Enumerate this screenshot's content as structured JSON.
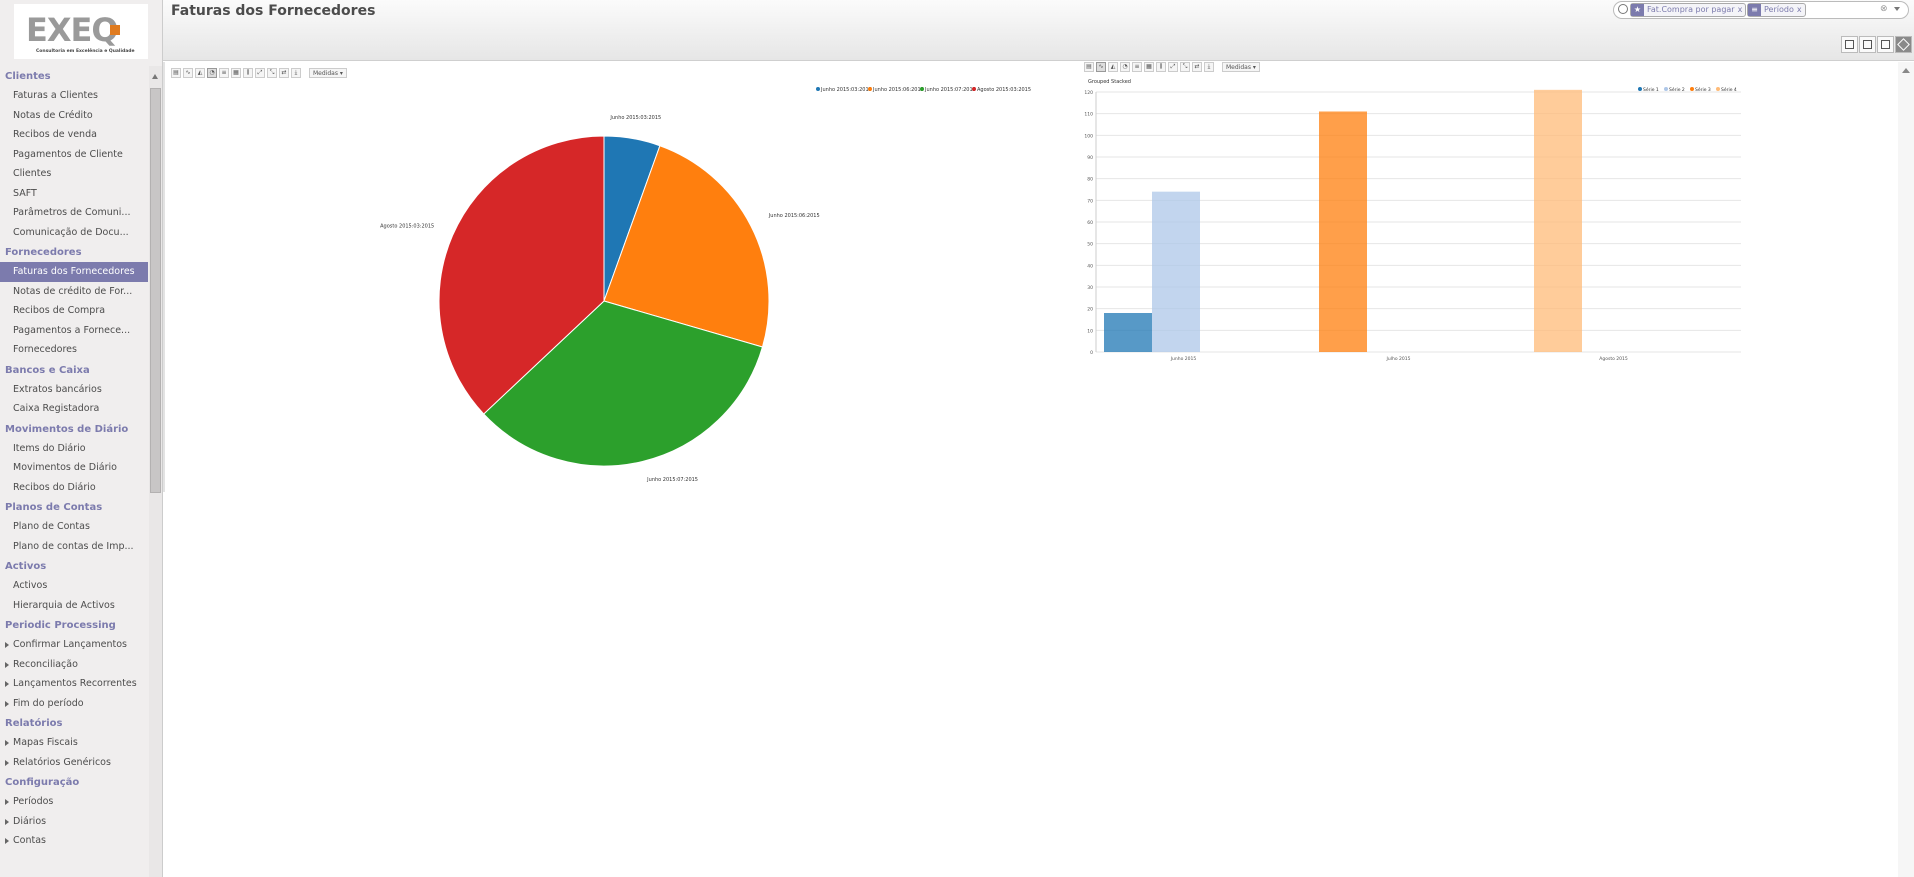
{
  "header": {
    "title": "Faturas dos Fornecedores",
    "search": {
      "facets": [
        {
          "icon": "star-icon",
          "label": "Fat.Compra por pagar"
        },
        {
          "icon": "filter-icon",
          "label": "Período"
        }
      ],
      "remove_glyph": "x",
      "clear_glyph": "⊗"
    },
    "views": [
      "list-view",
      "form-view",
      "calendar-view",
      "graph-view"
    ],
    "active_view": "graph-view"
  },
  "logo": {
    "text": "EXEQ",
    "tagline": "Consultoria em Excelência e Qualidade",
    "colors": {
      "gray": "#8f8f8f",
      "orange": "#e07b1f"
    }
  },
  "sidebar": {
    "sections": [
      {
        "title": "Clientes",
        "items": [
          {
            "label": "Faturas a Clientes"
          },
          {
            "label": "Notas de Crédito"
          },
          {
            "label": "Recibos de venda"
          },
          {
            "label": "Pagamentos de Cliente"
          },
          {
            "label": "Clientes"
          },
          {
            "label": "SAFT"
          },
          {
            "label": "Parâmetros de Comuni..."
          },
          {
            "label": "Comunicação de Docu..."
          }
        ]
      },
      {
        "title": "Fornecedores",
        "items": [
          {
            "label": "Faturas dos Fornecedores",
            "active": true
          },
          {
            "label": "Notas de crédito de For..."
          },
          {
            "label": "Recibos de Compra"
          },
          {
            "label": "Pagamentos a Fornece..."
          },
          {
            "label": "Fornecedores"
          }
        ]
      },
      {
        "title": "Bancos e Caixa",
        "items": [
          {
            "label": "Extratos bancários"
          },
          {
            "label": "Caixa Registadora"
          }
        ]
      },
      {
        "title": "Movimentos de Diário",
        "items": [
          {
            "label": "Items do Diário"
          },
          {
            "label": "Movimentos de Diário"
          },
          {
            "label": "Recibos do Diário"
          }
        ]
      },
      {
        "title": "Planos de Contas",
        "items": [
          {
            "label": "Plano de Contas"
          },
          {
            "label": "Plano de contas de Imp..."
          }
        ]
      },
      {
        "title": "Activos",
        "items": [
          {
            "label": "Activos"
          },
          {
            "label": "Hierarquia de Activos"
          }
        ]
      },
      {
        "title": "Periodic Processing",
        "items": [
          {
            "label": "Confirmar Lançamentos",
            "sub": true
          },
          {
            "label": "Reconciliação",
            "sub": true
          },
          {
            "label": "Lançamentos Recorrentes",
            "sub": true
          },
          {
            "label": "Fim do período",
            "sub": true
          }
        ]
      },
      {
        "title": "Relatórios",
        "items": [
          {
            "label": "Mapas Fiscais",
            "sub": true
          },
          {
            "label": "Relatórios Genéricos",
            "sub": true
          }
        ]
      },
      {
        "title": "Configuração",
        "items": [
          {
            "label": "Períodos",
            "sub": true
          },
          {
            "label": "Diários",
            "sub": true
          },
          {
            "label": "Contas",
            "sub": true
          }
        ]
      }
    ]
  },
  "pie_toolbar": {
    "measure_label": "Medidas ▾"
  },
  "bar_toolbar": {
    "measure_label": "Medidas ▾"
  },
  "chart_data": [
    {
      "type": "pie",
      "legend_placement": "top-right",
      "labels": [
        "Junho 2015:03:2015",
        "Junho 2015:06:2015",
        "Junho 2015:07:2015",
        "Agosto 2015:03:2015"
      ],
      "values": [
        5.5,
        24.0,
        33.5,
        37.0
      ],
      "colors": [
        "#1f77b4",
        "#ff7f0e",
        "#2ca02c",
        "#d62728"
      ]
    },
    {
      "type": "bar",
      "legend_placement": "top-right",
      "categories": [
        "Junho 2015",
        "Julho 2015",
        "Agosto 2015"
      ],
      "toggles": [
        "Grouped",
        "Stacked"
      ],
      "y_ticks": [
        0,
        10,
        20,
        30,
        40,
        50,
        60,
        70,
        80,
        90,
        100,
        110,
        120
      ],
      "ylim": [
        0,
        120
      ],
      "grid": true,
      "series": [
        {
          "name": "Série 1",
          "color": "#1f77b4",
          "values": [
            18,
            0,
            0
          ]
        },
        {
          "name": "Série 2",
          "color": "#aec7e8",
          "values": [
            74,
            0,
            0
          ]
        },
        {
          "name": "Série 3",
          "color": "#ff7f0e",
          "values": [
            0,
            111,
            0
          ]
        },
        {
          "name": "Série 4",
          "color": "#ffbb78",
          "values": [
            0,
            0,
            121
          ]
        }
      ]
    }
  ]
}
